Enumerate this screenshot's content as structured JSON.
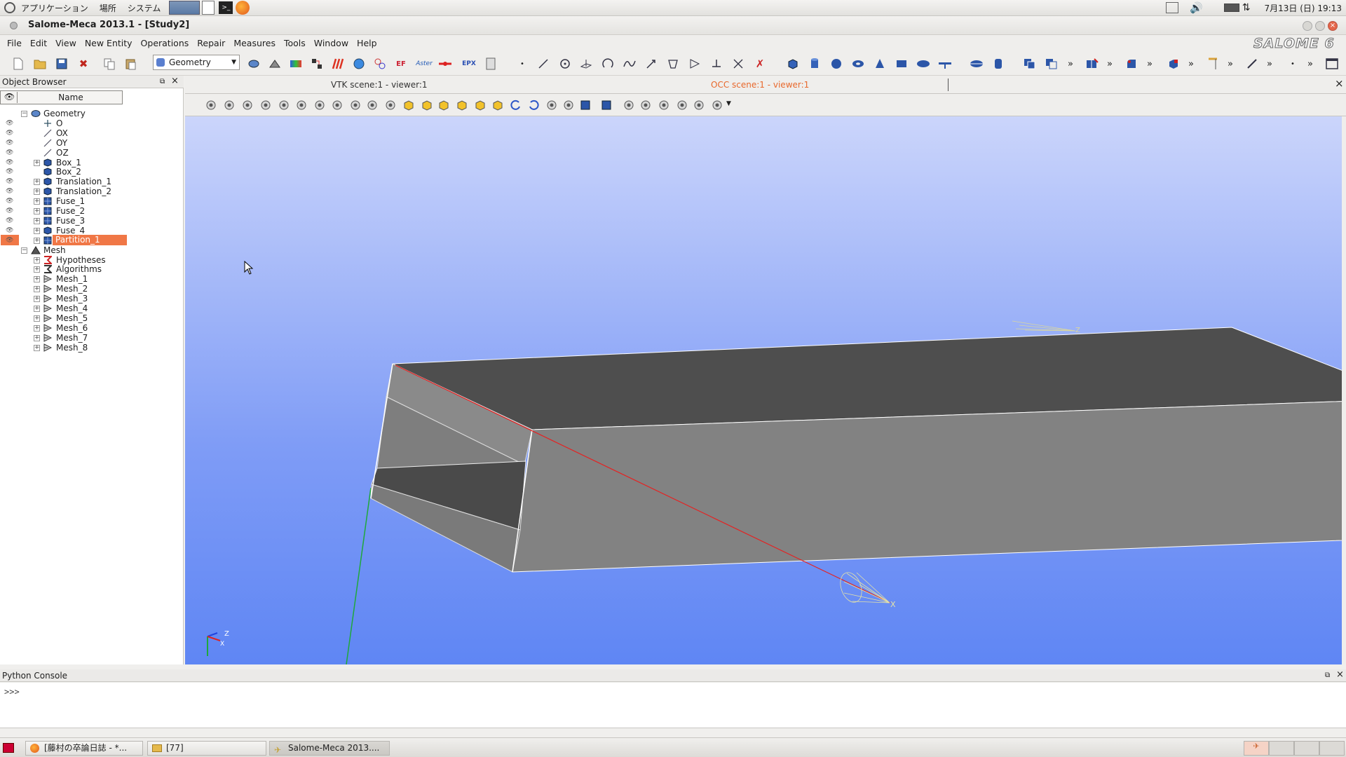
{
  "panel": {
    "menus": [
      "アプリケーション",
      "場所",
      "システム"
    ],
    "clock": "7月13日 (日) 19:13"
  },
  "window": {
    "title": "Salome-Meca 2013.1 - [Study2]",
    "logo": "SALOME 6"
  },
  "menubar": [
    "File",
    "Edit",
    "View",
    "New Entity",
    "Operations",
    "Repair",
    "Measures",
    "Tools",
    "Window",
    "Help"
  ],
  "toolbar": {
    "module_select": "Geometry",
    "aster_label": "Aster",
    "epx_label": "EPX",
    "more_label": "»"
  },
  "object_browser": {
    "title": "Object Browser",
    "column_name": "Name",
    "tree": [
      {
        "label": "Geometry",
        "depth": 0,
        "expanded": true,
        "icon": "geometry-component-icon",
        "eye": false
      },
      {
        "label": "O",
        "depth": 1,
        "icon": "point-icon",
        "eye": true
      },
      {
        "label": "OX",
        "depth": 1,
        "icon": "vector-icon",
        "eye": true
      },
      {
        "label": "OY",
        "depth": 1,
        "icon": "vector-icon",
        "eye": true
      },
      {
        "label": "OZ",
        "depth": 1,
        "icon": "vector-icon",
        "eye": true
      },
      {
        "label": "Box_1",
        "depth": 1,
        "expandable": true,
        "icon": "solid-icon",
        "eye": true
      },
      {
        "label": "Box_2",
        "depth": 1,
        "icon": "solid-icon",
        "eye": true
      },
      {
        "label": "Translation_1",
        "depth": 1,
        "expandable": true,
        "icon": "solid-icon",
        "eye": true
      },
      {
        "label": "Translation_2",
        "depth": 1,
        "expandable": true,
        "icon": "solid-icon",
        "eye": true
      },
      {
        "label": "Fuse_1",
        "depth": 1,
        "expandable": true,
        "icon": "compound-icon",
        "eye": true
      },
      {
        "label": "Fuse_2",
        "depth": 1,
        "expandable": true,
        "icon": "compound-icon",
        "eye": true
      },
      {
        "label": "Fuse_3",
        "depth": 1,
        "expandable": true,
        "icon": "compound-icon",
        "eye": true
      },
      {
        "label": "Fuse_4",
        "depth": 1,
        "expandable": true,
        "icon": "solid-icon",
        "eye": true
      },
      {
        "label": "Partition_1",
        "depth": 1,
        "expandable": true,
        "icon": "compound-icon",
        "eye": true,
        "selected": true
      },
      {
        "label": "Mesh",
        "depth": 0,
        "expanded": true,
        "icon": "mesh-component-icon",
        "eye": false
      },
      {
        "label": "Hypotheses",
        "depth": 1,
        "expandable": true,
        "icon": "hypothesis-icon",
        "eye": false
      },
      {
        "label": "Algorithms",
        "depth": 1,
        "expandable": true,
        "icon": "algorithm-icon",
        "eye": false
      },
      {
        "label": "Mesh_1",
        "depth": 1,
        "expandable": true,
        "icon": "mesh-object-icon",
        "eye": false
      },
      {
        "label": "Mesh_2",
        "depth": 1,
        "expandable": true,
        "icon": "mesh-object-icon",
        "eye": false
      },
      {
        "label": "Mesh_3",
        "depth": 1,
        "expandable": true,
        "icon": "mesh-object-icon",
        "eye": false
      },
      {
        "label": "Mesh_4",
        "depth": 1,
        "expandable": true,
        "icon": "mesh-object-icon",
        "eye": false
      },
      {
        "label": "Mesh_5",
        "depth": 1,
        "expandable": true,
        "icon": "mesh-object-icon",
        "eye": false
      },
      {
        "label": "Mesh_6",
        "depth": 1,
        "expandable": true,
        "icon": "mesh-object-icon",
        "eye": false
      },
      {
        "label": "Mesh_7",
        "depth": 1,
        "expandable": true,
        "icon": "mesh-object-icon",
        "eye": false
      },
      {
        "label": "Mesh_8",
        "depth": 1,
        "expandable": true,
        "icon": "mesh-object-icon",
        "eye": false
      }
    ]
  },
  "viewer": {
    "tabs": [
      "VTK scene:1 - viewer:1",
      "OCC scene:1 - viewer:1"
    ],
    "active_tab": 1,
    "axis_labels": {
      "x": "X",
      "z": "Z"
    },
    "triad_labels": {
      "z": "Z",
      "x": "X"
    }
  },
  "console": {
    "title": "Python Console",
    "prompt": ">>>"
  },
  "taskbar": {
    "items": [
      "[藤村の卒論日誌 - *...",
      "[77]",
      "Salome-Meca 2013...."
    ]
  },
  "colors": {
    "selection": "#f07746",
    "active_tab_text": "#e8682c",
    "scene_top": "#cbd5fb",
    "scene_bottom": "#5f86f4"
  }
}
